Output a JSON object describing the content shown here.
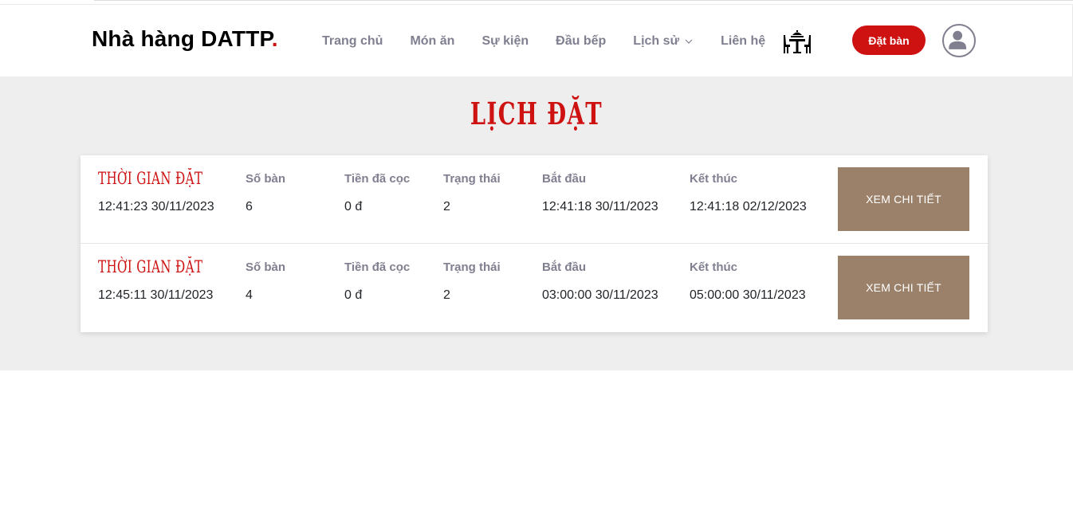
{
  "brand": {
    "name": "Nhà hàng DATTP",
    "dot": ".",
    "accent": "#ce1212"
  },
  "nav": {
    "items": [
      {
        "label": "Trang chủ"
      },
      {
        "label": "Món ăn"
      },
      {
        "label": "Sự kiện"
      },
      {
        "label": "Đầu bếp"
      },
      {
        "label": "Lịch sử",
        "icon": "chevron-down-icon"
      },
      {
        "label": "Liên hệ"
      }
    ],
    "table_icon": "dining-table-icon",
    "book_button": "Đặt bàn",
    "avatar_icon": "user-icon"
  },
  "page": {
    "title": "LỊCH ĐẶT",
    "colors": {
      "background": "#eeeeee",
      "button": "#9b816a"
    }
  },
  "bookings": {
    "labels": {
      "time": "THỜI GIAN ĐẶT",
      "table": "Số bàn",
      "deposit": "Tiền đã cọc",
      "status": "Trạng thái",
      "start": "Bắt đầu",
      "end": "Kết thúc",
      "detail_button": "XEM CHI TIẾT"
    },
    "rows": [
      {
        "time": "12:41:23 30/11/2023",
        "table": "6",
        "deposit": "0 đ",
        "status": "2",
        "start": "12:41:18 30/11/2023",
        "end": "12:41:18 02/12/2023"
      },
      {
        "time": "12:45:11 30/11/2023",
        "table": "4",
        "deposit": "0 đ",
        "status": "2",
        "start": "03:00:00 30/11/2023",
        "end": "05:00:00 30/11/2023"
      }
    ]
  }
}
